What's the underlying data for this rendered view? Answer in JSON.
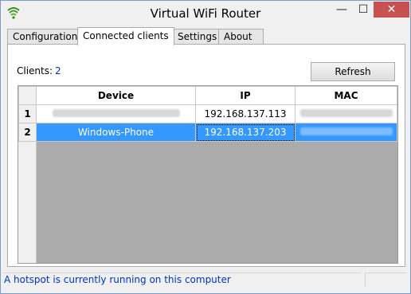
{
  "window": {
    "title": "Virtual WiFi Router",
    "minimize": "—",
    "maximize": "☐",
    "close": "✕",
    "icon": "wifi-signal-icon",
    "accent": "#4b9a2b"
  },
  "tabs": [
    {
      "label": "Configuration",
      "active": false
    },
    {
      "label": "Connected clients",
      "active": true
    },
    {
      "label": "Settings",
      "active": false
    },
    {
      "label": "About",
      "active": false
    }
  ],
  "clients": {
    "label": "Clients:",
    "count": "2",
    "refresh_label": "Refresh"
  },
  "table": {
    "columns": [
      "Device",
      "IP",
      "MAC"
    ],
    "rows": [
      {
        "num": "1",
        "device": "",
        "ip": "192.168.137.113",
        "mac": "",
        "selected": false
      },
      {
        "num": "2",
        "device": "Windows-Phone",
        "ip": "192.168.137.203",
        "mac": "",
        "selected": true
      }
    ]
  },
  "status": {
    "text": "A hotspot is currently running on this computer",
    "color": "#0033cc"
  },
  "colors": {
    "selection": "#3399ff",
    "close_button": "#c75050"
  }
}
